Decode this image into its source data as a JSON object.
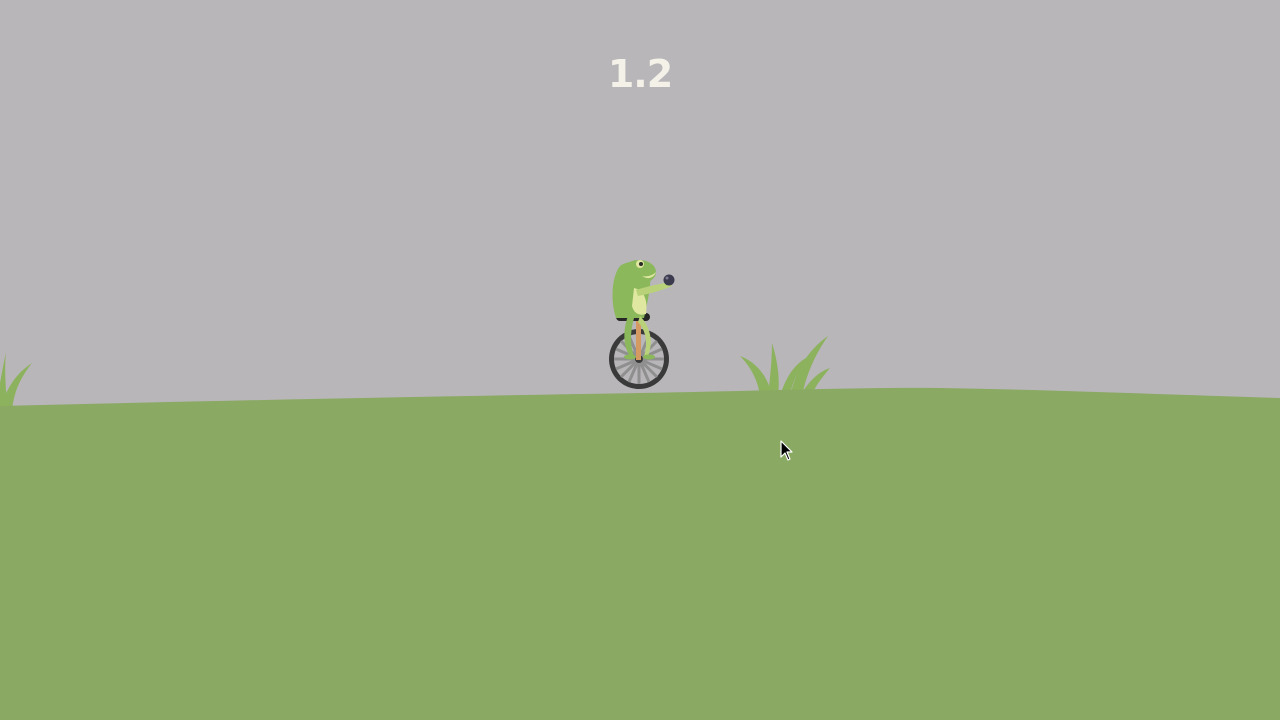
{
  "hud": {
    "score": "1.2"
  },
  "colors": {
    "sky": "#b8b6b9",
    "ground": "#8aa962",
    "grass": "#8db25e",
    "frog_body": "#8ab85a",
    "frog_belly": "#dfe7a0",
    "tire": "#3a3a3a",
    "spoke": "#9a9a9a",
    "ball": "#3b3a4e",
    "score_text": "#f4f1e8"
  },
  "icons": {
    "cursor": "mouse-pointer-icon"
  }
}
